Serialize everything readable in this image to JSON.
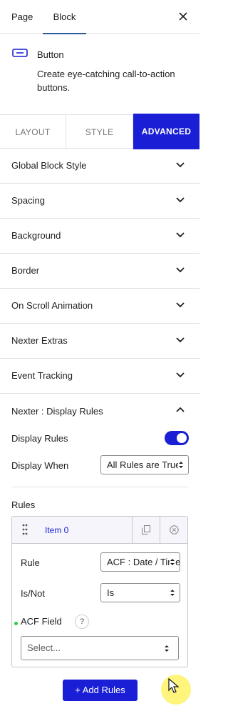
{
  "top_tabs": {
    "page": "Page",
    "block": "Block"
  },
  "block": {
    "title": "Button",
    "description": "Create eye-catching call-to-action buttons."
  },
  "sub_tabs": {
    "layout": "LAYOUT",
    "style": "STYLE",
    "advanced": "ADVANCED"
  },
  "panels": [
    "Global Block Style",
    "Spacing",
    "Background",
    "Border",
    "On Scroll Animation",
    "Nexter Extras",
    "Event Tracking"
  ],
  "display_rules": {
    "title": "Nexter : Display Rules",
    "display_rules_label": "Display Rules",
    "enabled": true,
    "display_when_label": "Display When",
    "display_when_value": "All Rules are True",
    "rules_label": "Rules",
    "item": {
      "label": "Item 0",
      "rule_label": "Rule",
      "rule_value": "ACF : Date / Time",
      "isnot_label": "Is/Not",
      "isnot_value": "Is",
      "acf_field_label": "ACF Field",
      "help_glyph": "?",
      "acf_field_placeholder": "Select..."
    },
    "add_button": "+ Add Rules"
  },
  "colors": {
    "accent": "#1a1fd6",
    "active_tab_underline": "#2f5a9e",
    "status_dot": "#2ecc40"
  },
  "icons": [
    "close-icon",
    "button-block-icon",
    "chevron-down-icon",
    "chevron-up-icon",
    "drag-handle-icon",
    "duplicate-icon",
    "remove-icon",
    "select-arrows-icon",
    "help-icon",
    "mouse-cursor-icon"
  ]
}
